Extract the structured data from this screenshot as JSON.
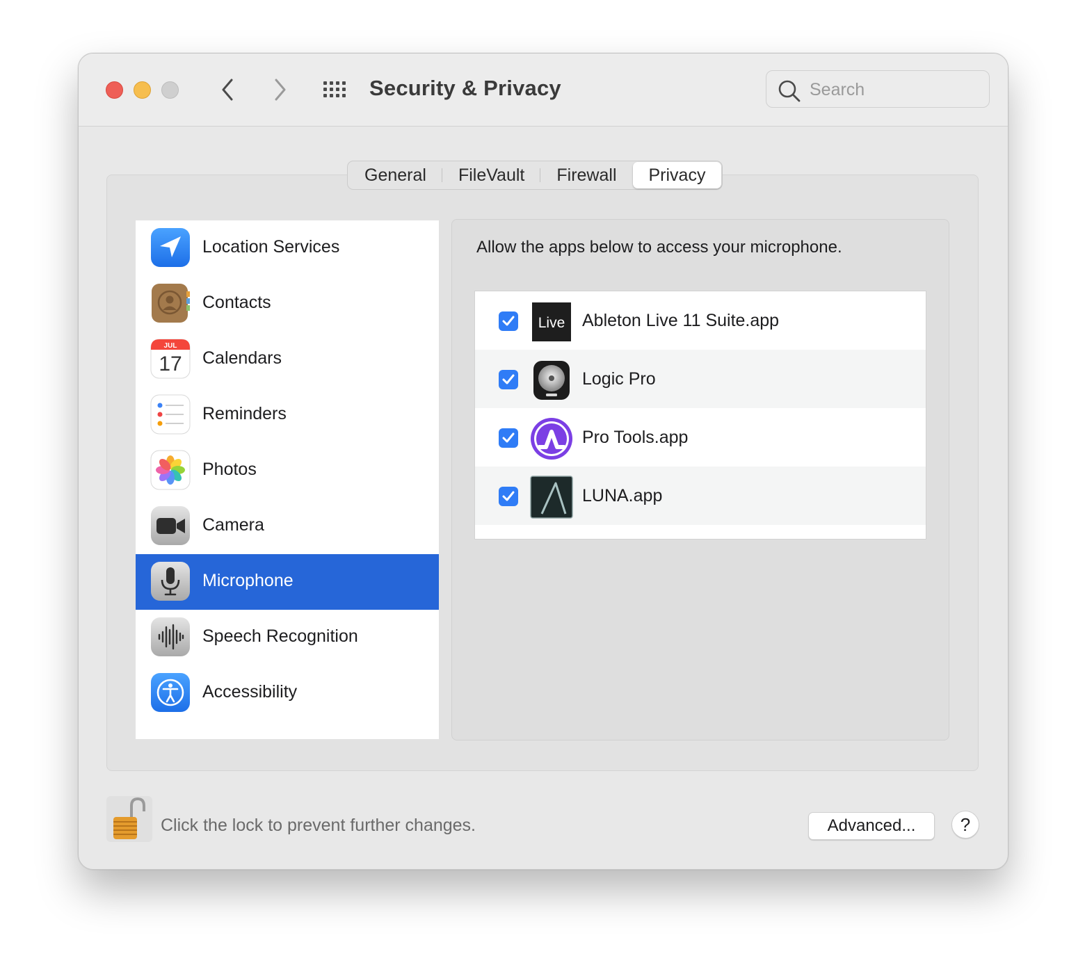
{
  "window": {
    "title": "Security & Privacy",
    "search_placeholder": "Search"
  },
  "tabs": [
    {
      "label": "General"
    },
    {
      "label": "FileVault"
    },
    {
      "label": "Firewall"
    },
    {
      "label": "Privacy",
      "active": true
    }
  ],
  "sidebar": {
    "items": [
      {
        "label": "Location Services",
        "icon": "location-arrow-icon"
      },
      {
        "label": "Contacts",
        "icon": "contacts-book-icon"
      },
      {
        "label": "Calendars",
        "icon": "calendar-icon",
        "icon_month": "JUL",
        "icon_day": "17"
      },
      {
        "label": "Reminders",
        "icon": "reminders-list-icon"
      },
      {
        "label": "Photos",
        "icon": "photos-flower-icon"
      },
      {
        "label": "Camera",
        "icon": "video-camera-icon"
      },
      {
        "label": "Microphone",
        "icon": "microphone-icon",
        "selected": true
      },
      {
        "label": "Speech Recognition",
        "icon": "waveform-icon"
      },
      {
        "label": "Accessibility",
        "icon": "accessibility-figure-icon"
      }
    ]
  },
  "main": {
    "description": "Allow the apps below to access your microphone.",
    "apps": [
      {
        "name": "Ableton Live 11 Suite.app",
        "checked": true,
        "icon": "ableton-live-icon",
        "icon_text": "Live"
      },
      {
        "name": "Logic Pro",
        "checked": true,
        "icon": "logic-pro-icon"
      },
      {
        "name": "Pro Tools.app",
        "checked": true,
        "icon": "pro-tools-icon"
      },
      {
        "name": "LUNA.app",
        "checked": true,
        "icon": "luna-icon"
      }
    ]
  },
  "footer": {
    "lock_text": "Click the lock to prevent further changes.",
    "advanced_label": "Advanced...",
    "help_label": "?"
  },
  "colors": {
    "selection": "#2666d8",
    "checkbox": "#2f7cf6",
    "window_bg": "#e8e8e8",
    "close": "#ee5f57",
    "minimize": "#f6be4f"
  }
}
